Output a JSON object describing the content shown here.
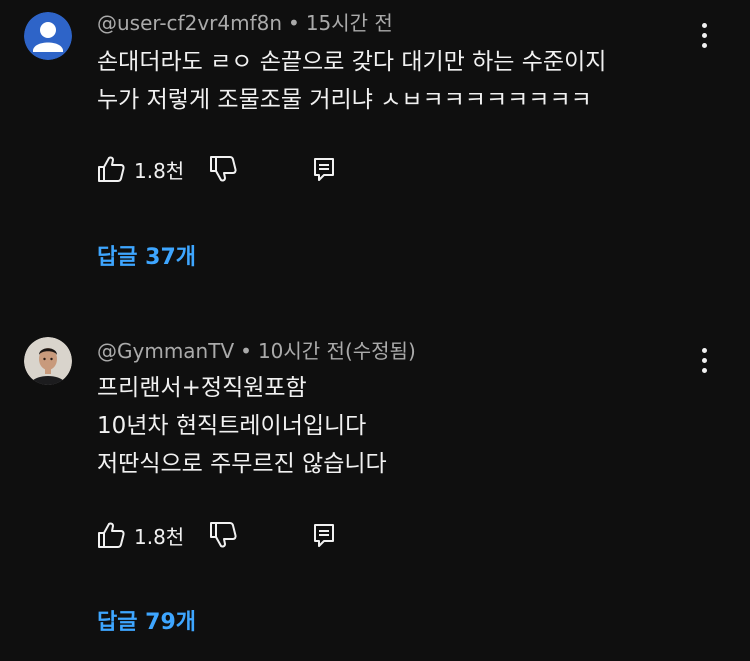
{
  "comments": [
    {
      "handle": "@user-cf2vr4mf8n",
      "separator": "•",
      "time": "15시간 전",
      "lines": [
        "손대더라도 ㄹㅇ 손끝으로 갖다 대기만 하는 수준이지",
        "누가 저렇게 조물조물 거리냐 ㅅㅂㅋㅋㅋㅋㅋㅋㅋㅋ"
      ],
      "likes": "1.8천",
      "replies": "답글 37개",
      "avatar": "default-user-avatar"
    },
    {
      "handle": "@GymmanTV",
      "separator": "•",
      "time": "10시간 전(수정됨)",
      "lines": [
        "프리랜서+정직원포함",
        "10년차 현직트레이너입니다",
        "저딴식으로 주무르진 않습니다"
      ],
      "likes": "1.8천",
      "replies": "답글 79개",
      "avatar": "photo-avatar"
    }
  ],
  "colors": {
    "background": "#0f0f0f",
    "text": "#f1f1f1",
    "meta": "#aaaaaa",
    "link": "#3ea6ff",
    "default_avatar": "#2e64c8"
  }
}
